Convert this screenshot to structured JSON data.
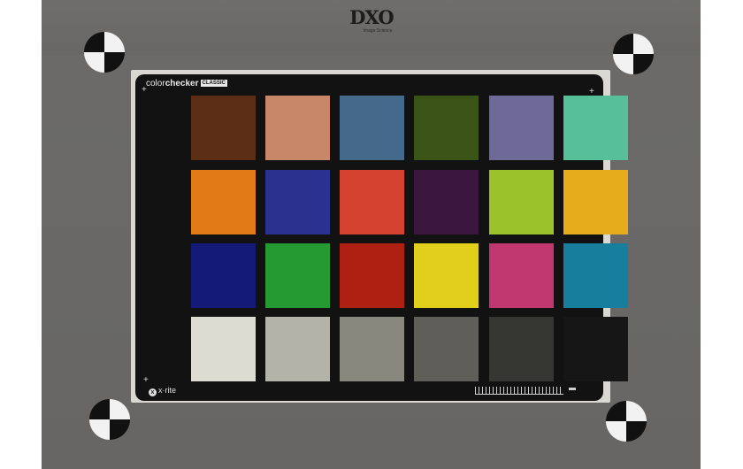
{
  "logo": {
    "mark": "DXO",
    "subtext": "Image Science"
  },
  "chart": {
    "brand_light": "color",
    "brand_bold": "checker",
    "edition": "CLASSIC",
    "maker": "x·rite",
    "maker_mark": "x"
  },
  "patches": [
    "#5b2e15",
    "#c98769",
    "#45698a",
    "#3a5418",
    "#6f6997",
    "#57c09a",
    "#e27a16",
    "#2b318e",
    "#d5422f",
    "#3b173f",
    "#9bc12b",
    "#e7ac1a",
    "#141a78",
    "#259a33",
    "#ad2012",
    "#e2cf1c",
    "#c1376f",
    "#177e9e",
    "#dddcd2",
    "#b3b3aa",
    "#88887f",
    "#5f5e58",
    "#363633",
    "#161616"
  ]
}
